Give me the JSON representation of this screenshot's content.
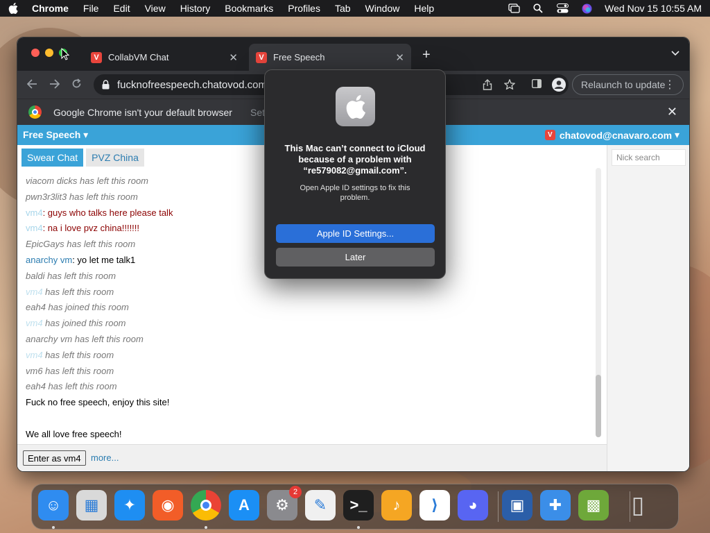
{
  "menubar": {
    "app_name": "Chrome",
    "menus": [
      "File",
      "Edit",
      "View",
      "History",
      "Bookmarks",
      "Profiles",
      "Tab",
      "Window",
      "Help"
    ],
    "datetime": "Wed Nov 15  10:55 AM"
  },
  "browser": {
    "tabs": [
      {
        "title": "CollabVM Chat",
        "active": false
      },
      {
        "title": "Free Speech",
        "active": true
      }
    ],
    "url": "fucknofreespeech.chatovod.com",
    "relaunch_label": "Relaunch to update",
    "infobar": {
      "message": "Google Chrome isn't your default browser",
      "action": "Set"
    }
  },
  "chat": {
    "room_menu": "Free Speech",
    "account": "chatovod@cnavaro.com",
    "room_tabs": [
      "Swear Chat",
      "PVZ China"
    ],
    "messages": [
      {
        "type": "sys",
        "text": "viacom dicks has left this room"
      },
      {
        "type": "sys",
        "text": "pwn3r3lit3 has left this room"
      },
      {
        "type": "chat",
        "nick": "vm4",
        "text": ": guys who talks here please talk",
        "style": "red"
      },
      {
        "type": "chat",
        "nick": "vm4",
        "text": ": na i love pvz china!!!!!!!",
        "style": "red"
      },
      {
        "type": "sys",
        "text": "EpicGays has left this room"
      },
      {
        "type": "chat2",
        "nick": "anarchy vm",
        "text": ": yo let me talk1"
      },
      {
        "type": "sys",
        "text": "baldi has left this room"
      },
      {
        "type": "sysnick",
        "nick": "vm4",
        "text": " has left this room"
      },
      {
        "type": "sys",
        "text": "eah4 has joined this room"
      },
      {
        "type": "sysnick",
        "nick": "vm4",
        "text": " has joined this room"
      },
      {
        "type": "sys",
        "text": "anarchy vm has left this room"
      },
      {
        "type": "sysnick",
        "nick": "vm4",
        "text": " has left this room"
      },
      {
        "type": "sys",
        "text": "vm6 has left this room"
      },
      {
        "type": "sys",
        "text": "eah4 has left this room"
      },
      {
        "type": "plain",
        "text": "Fuck no free speech, enjoy this site!"
      },
      {
        "type": "blank",
        "text": ""
      },
      {
        "type": "plain",
        "text": "We all love free speech!"
      }
    ],
    "enter_button": "Enter as vm4",
    "more_link": "more...",
    "nick_search_placeholder": "Nick search"
  },
  "dialog": {
    "title": "This Mac can’t connect to iCloud because of a problem with “re579082@gmail.com”.",
    "body": "Open Apple ID settings to fix this problem.",
    "primary_button": "Apple ID Settings...",
    "secondary_button": "Later"
  },
  "dock": {
    "apps": [
      {
        "name": "finder",
        "color": "#2f8cf0",
        "running": true
      },
      {
        "name": "launchpad",
        "color": "#d9d9d9",
        "running": false
      },
      {
        "name": "safari",
        "color": "#1e8ef2",
        "running": false
      },
      {
        "name": "firefox",
        "color": "#f25d28",
        "running": false
      },
      {
        "name": "chrome",
        "color": "#ffffff",
        "running": true
      },
      {
        "name": "app-store",
        "color": "#1b8ff5",
        "running": false
      },
      {
        "name": "system-settings",
        "color": "#8a8a8e",
        "running": false,
        "badge": "2"
      },
      {
        "name": "textedit",
        "color": "#f0f0f0",
        "running": false
      },
      {
        "name": "terminal",
        "color": "#1f1f1f",
        "running": true
      },
      {
        "name": "garageband",
        "color": "#f5a623",
        "running": false
      },
      {
        "name": "vscode",
        "color": "#ffffff",
        "running": false
      },
      {
        "name": "discord",
        "color": "#5865f2",
        "running": false
      },
      {
        "name": "virtualbox",
        "color": "#2b5ea8",
        "running": false
      },
      {
        "name": "game-controller",
        "color": "#3b8ee8",
        "running": false
      },
      {
        "name": "minecraft",
        "color": "#6ea83a",
        "running": false
      },
      {
        "name": "trash",
        "color": "#8e8e93",
        "running": false
      }
    ]
  }
}
